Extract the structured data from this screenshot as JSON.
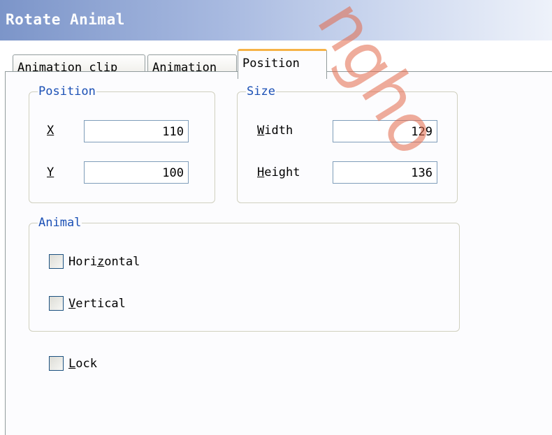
{
  "window": {
    "title": "Rotate Animal"
  },
  "watermark": "ngho",
  "tabs": [
    {
      "label": "Animation clip",
      "active": false
    },
    {
      "label": "Animation",
      "active": false
    },
    {
      "label": "Position",
      "active": true
    }
  ],
  "position_group": {
    "legend": "Position",
    "x": {
      "mnemonic": "X",
      "rest": "",
      "value": "110"
    },
    "y": {
      "mnemonic": "Y",
      "rest": "",
      "value": "100"
    }
  },
  "size_group": {
    "legend": "Size",
    "width": {
      "mnemonic": "W",
      "rest": "idth",
      "value": "129"
    },
    "height": {
      "mnemonic": "H",
      "rest": "eight",
      "value": "136"
    }
  },
  "animal_group": {
    "legend": "Animal",
    "horizontal": {
      "pre": "Hori",
      "mnemonic": "z",
      "post": "ontal",
      "checked": false
    },
    "vertical": {
      "pre": "",
      "mnemonic": "V",
      "post": "ertical",
      "checked": false
    }
  },
  "lock": {
    "pre": "",
    "mnemonic": "L",
    "post": "ock",
    "checked": false
  }
}
